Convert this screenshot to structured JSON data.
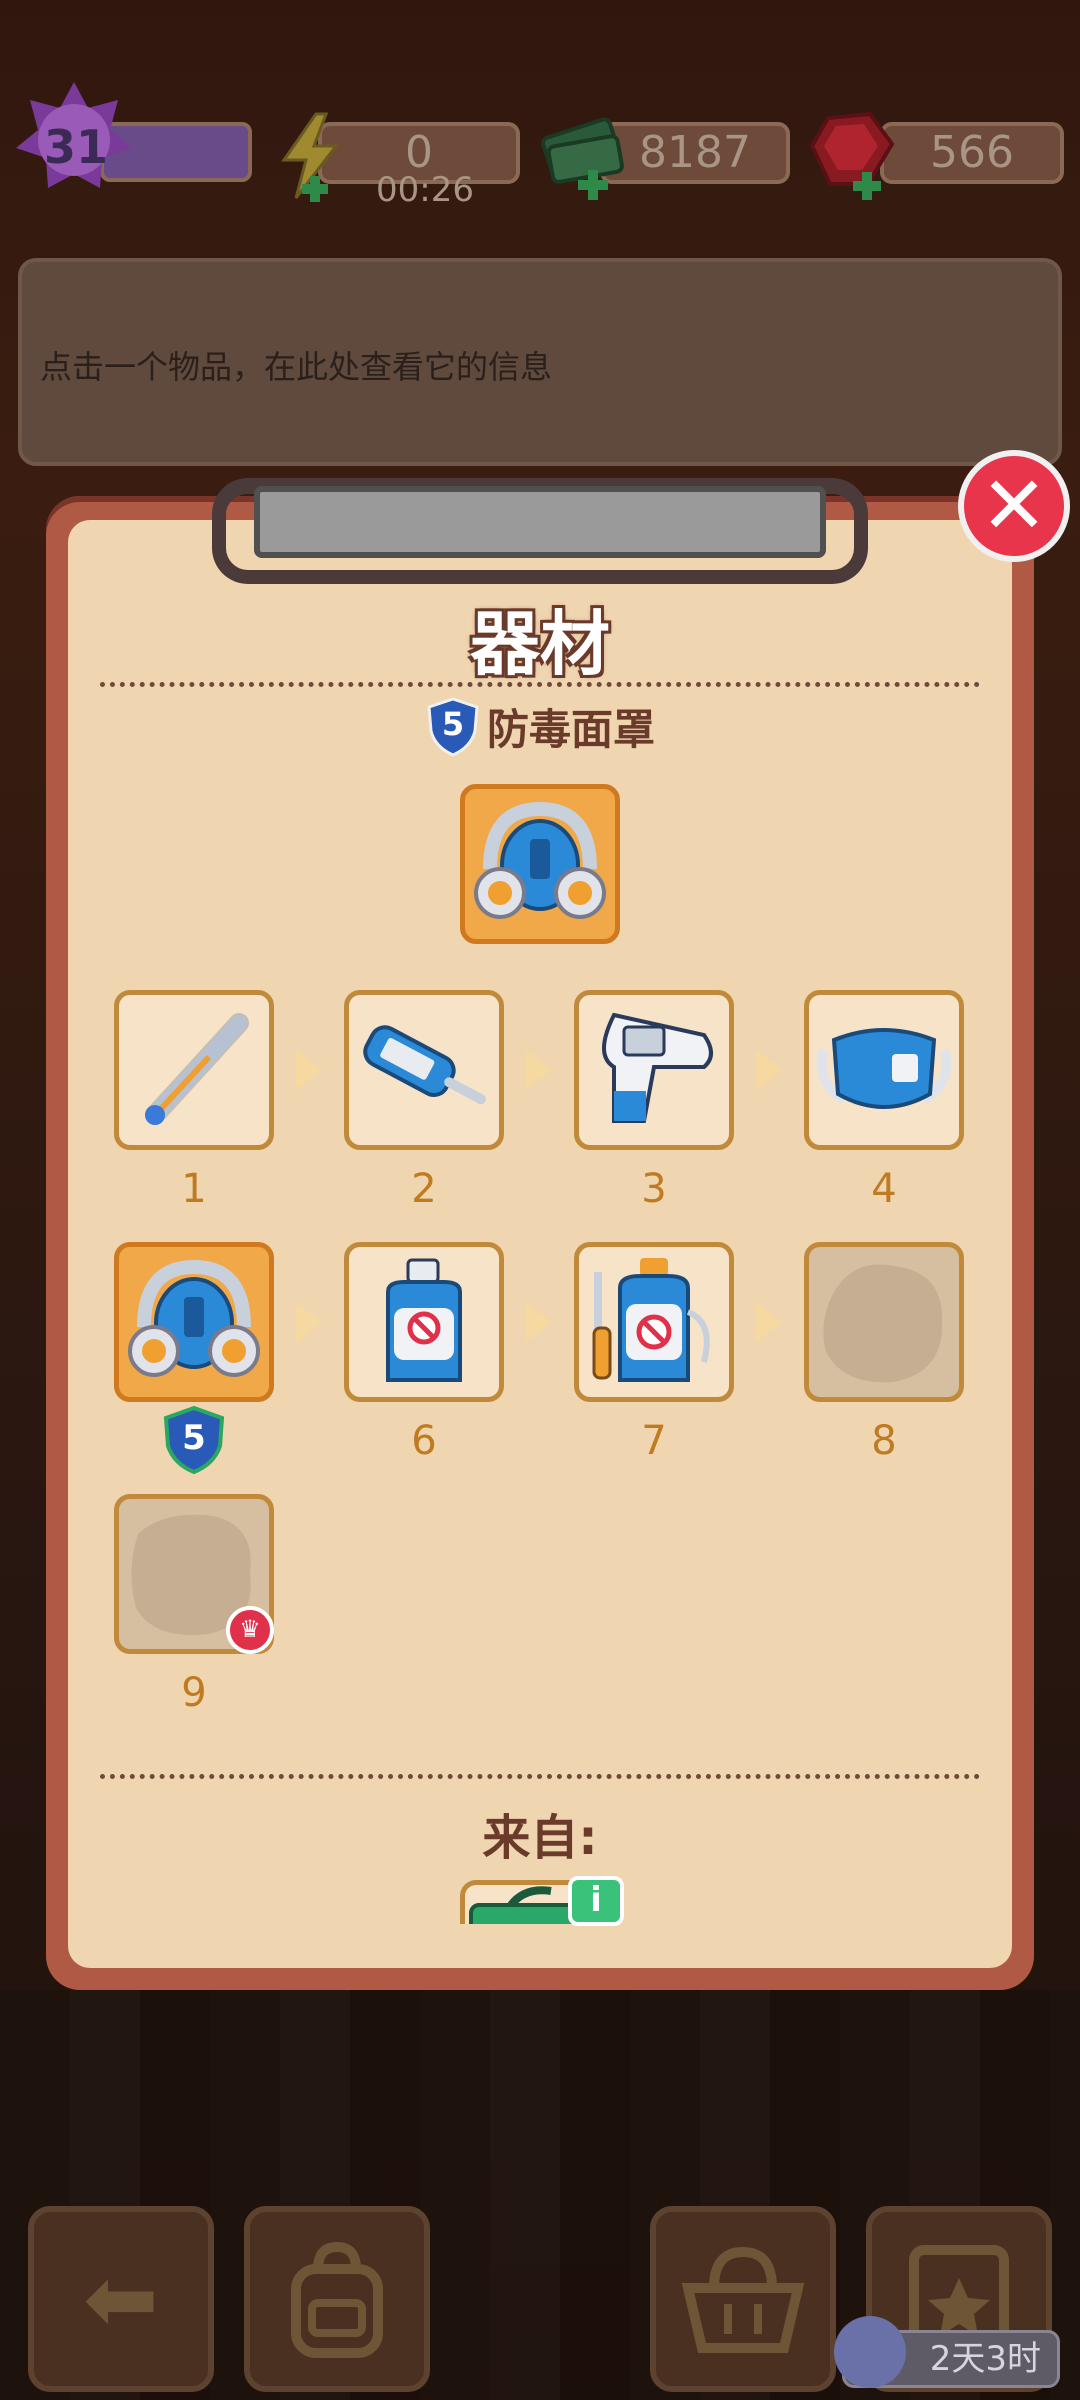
{
  "topbar": {
    "level": "31",
    "energy": "0",
    "energy_timer": "00:26",
    "cash": "8187",
    "gems": "566"
  },
  "info_panel": {
    "text": "点击一个物品，在此处查看它的信息"
  },
  "modal": {
    "title": "器材",
    "subtitle": "防毒面罩",
    "subtitle_level": "5",
    "close_label": "✕",
    "from_label": "来自:",
    "info_badge": "i",
    "items": [
      {
        "num": "1",
        "name": "thermometer-icon"
      },
      {
        "num": "2",
        "name": "digital-thermometer-icon"
      },
      {
        "num": "3",
        "name": "infrared-thermometer-icon"
      },
      {
        "num": "4",
        "name": "face-mask-icon"
      },
      {
        "num": "",
        "name": "gas-mask-icon",
        "level": "5",
        "current": true
      },
      {
        "num": "6",
        "name": "spray-bottle-icon"
      },
      {
        "num": "7",
        "name": "pressure-sprayer-icon"
      },
      {
        "num": "8",
        "name": "locked-item-icon"
      },
      {
        "num": "9",
        "name": "locked-item-icon"
      }
    ]
  },
  "bottom": {
    "timer": "2天3时"
  },
  "colors": {
    "accent": "#e8354b",
    "tile_border": "#c08a3a",
    "panel": "#efd5b0"
  }
}
